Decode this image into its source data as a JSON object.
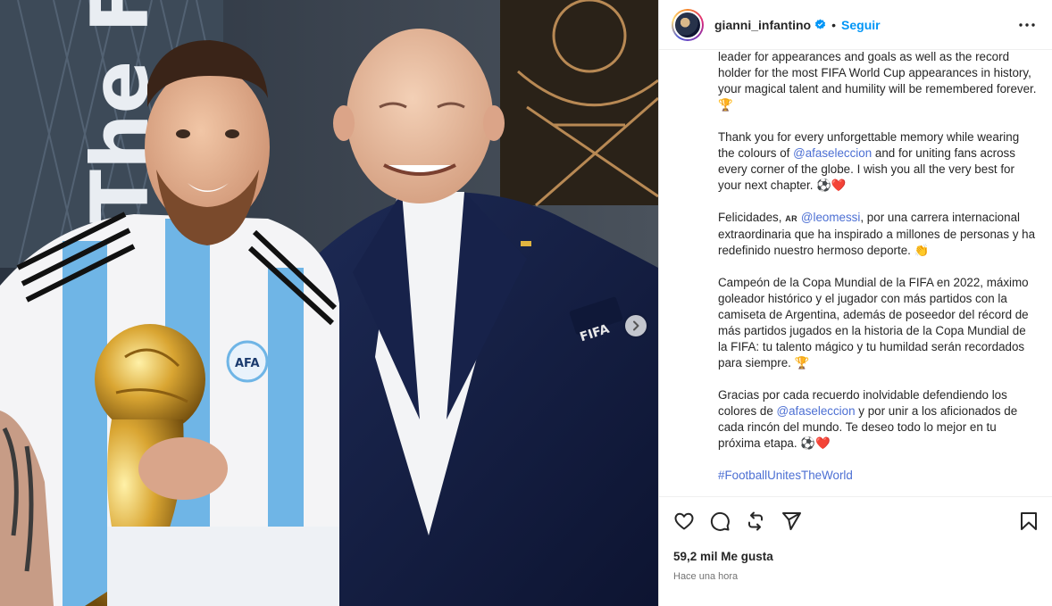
{
  "post": {
    "username": "gianni_infantino",
    "dot": "•",
    "follow_label": "Seguir",
    "image_text": {
      "wall_letters": "The F",
      "crest_text": "AFA",
      "badge_text": "FIFA"
    },
    "caption": {
      "p1": "leader for appearances and goals as well as the record holder for the most FIFA World Cup appearances in history, your magical talent and humility will be remembered forever. 🏆",
      "p2_a": "Thank you for every unforgettable memory while wearing the colours of ",
      "p2_mention": "@afaseleccion",
      "p2_b": " and for uniting fans across every corner of the globe. I wish you all the very best for your next chapter. ⚽❤️",
      "p3_a": "Felicidades, ",
      "p3_flag": "AR",
      "p3_mention": "@leomessi",
      "p3_b": ", por una carrera internacional extraordinaria que ha inspirado a millones de personas y ha redefinido nuestro hermoso deporte. 👏",
      "p4": "Campeón de la Copa Mundial de la FIFA en 2022, máximo goleador histórico y el jugador con más partidos con la camiseta de Argentina, además de poseedor del récord de más partidos jugados en la historia de la Copa Mundial de la FIFA: tu talento mágico y tu humildad serán recordados para siempre. 🏆",
      "p5_a": "Gracias por cada recuerdo inolvidable defendiendo los colores de ",
      "p5_mention": "@afaseleccion",
      "p5_b": " y por unir a los aficionados de cada rincón del mundo. Te deseo todo lo mejor en tu próxima etapa. ⚽❤️",
      "hashtag": "#FootballUnitesTheWorld"
    },
    "likes": "59,2 mil Me gusta",
    "time": "Hace una hora",
    "icons": {
      "verified": "verified-badge-icon",
      "more": "more-options-icon",
      "like": "heart-icon",
      "comment": "comment-icon",
      "repost": "repost-icon",
      "share": "share-icon",
      "save": "bookmark-icon",
      "next": "chevron-right-icon"
    },
    "colors": {
      "accent": "#0095f6",
      "verified": "#0095f6",
      "mention": "#4c6fd3",
      "text": "#262626",
      "muted": "#737373"
    }
  }
}
